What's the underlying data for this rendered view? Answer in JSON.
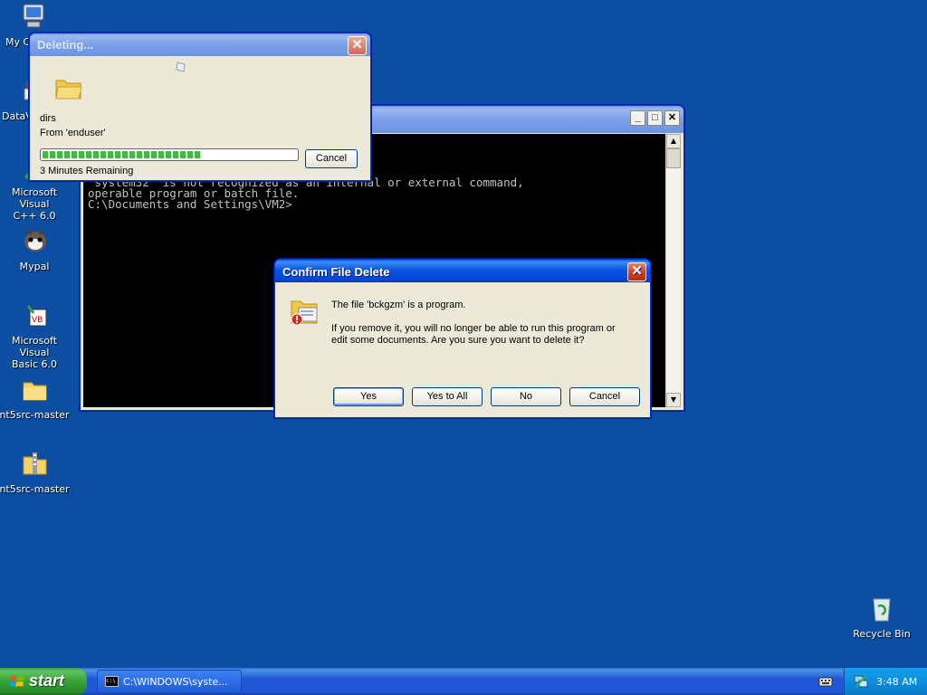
{
  "desktop": {
    "icons": [
      {
        "label": "My C",
        "icon": "my-computer-icon"
      },
      {
        "label": "DataV",
        "icon": "datav-shortcut-icon"
      },
      {
        "label": "Microsoft Visual\nC++ 6.0",
        "icon": "visual-cpp-icon"
      },
      {
        "label": "Mypal",
        "icon": "mypal-browser-icon"
      },
      {
        "label": "Microsoft Visual\nBasic 6.0",
        "icon": "visual-basic-icon"
      },
      {
        "label": "nt5src-master",
        "icon": "folder-icon"
      },
      {
        "label": "nt5src-master",
        "icon": "zip-folder-icon"
      },
      {
        "label": "Recycle Bin",
        "icon": "recycle-bin-icon"
      }
    ]
  },
  "console": {
    "lines": [
      "'system32' is not recognized as an internal or external command,",
      "operable program or batch file.",
      "",
      "C:\\Documents and Settings\\VM2>"
    ]
  },
  "deleting": {
    "title": "Deleting...",
    "item_name": "dirs",
    "from_text": "From 'enduser'",
    "progress_fraction": 0.62,
    "remaining": "3 Minutes Remaining",
    "cancel_label": "Cancel"
  },
  "confirm": {
    "title": "Confirm File Delete",
    "message_line1": "The file 'bckgzm' is a program.",
    "message_line2": "If you remove it, you will no longer be able to run this program or",
    "message_line3": "edit some documents. Are you sure you want to delete it?",
    "yes_label": "Yes",
    "yes_all_label": "Yes to All",
    "no_label": "No",
    "cancel_label": "Cancel"
  },
  "taskbar": {
    "start_label": "start",
    "task_label": "C:\\WINDOWS\\syste...",
    "clock": "3:48 AM"
  },
  "colors": {
    "desktop": "#0b4ea2",
    "title_active": "#0446d8",
    "progress": "#34c134"
  }
}
